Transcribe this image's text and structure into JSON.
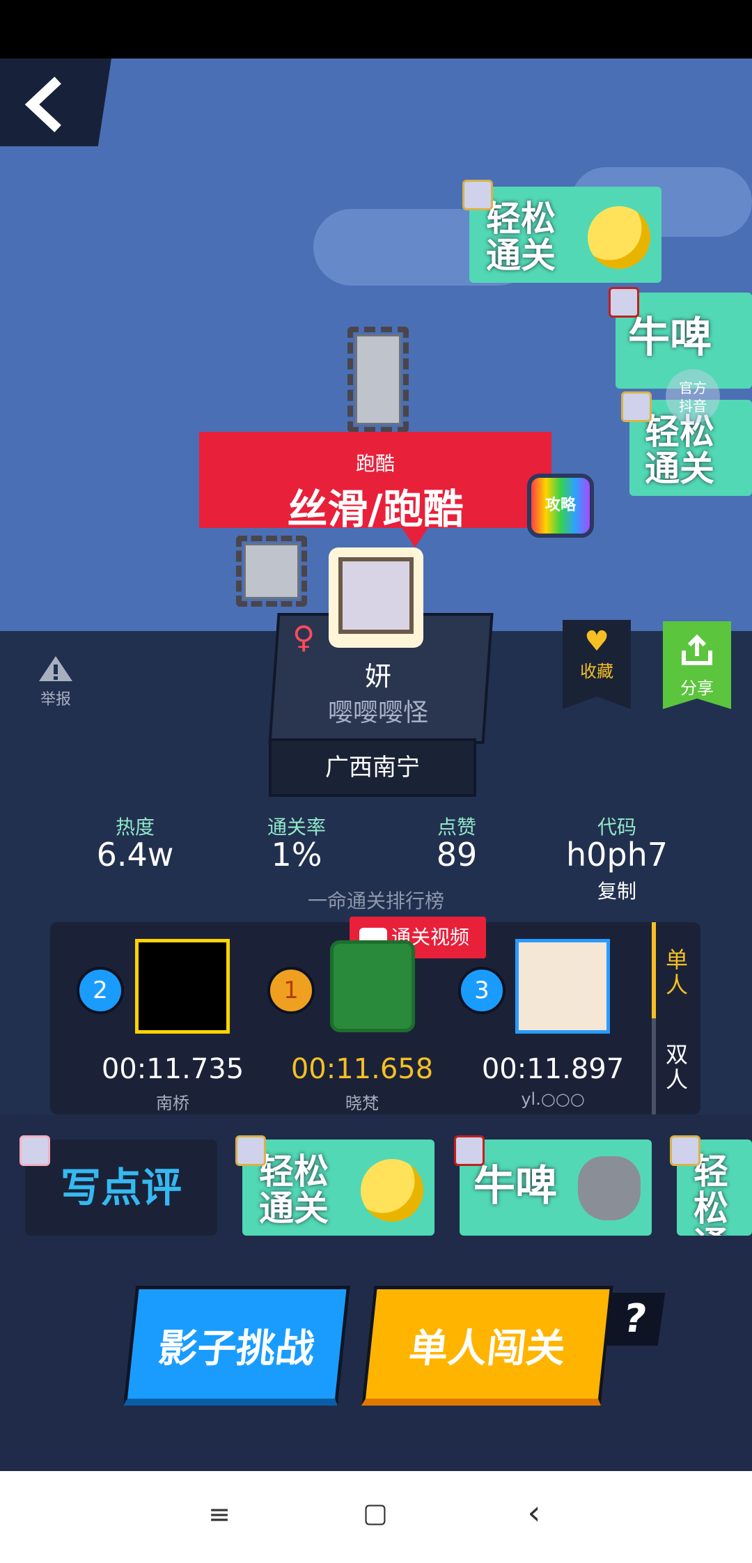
{
  "app": {
    "back_icon": "back-arrow-icon"
  },
  "reactions_top": [
    {
      "line1": "轻松",
      "line2": "通关"
    },
    {
      "line1": "牛啤",
      "line2": ""
    },
    {
      "line1": "轻松",
      "line2": "通关"
    }
  ],
  "watermark": {
    "line1": "官方",
    "line2": "抖音"
  },
  "level": {
    "category": "跑酷",
    "title": "丝滑/跑酷",
    "guide_label": "攻略"
  },
  "author": {
    "gender_symbol": "♀",
    "name": "妍",
    "subtitle": "嘤嘤嘤怪",
    "location": "广西南宁"
  },
  "actions": {
    "report": "举报",
    "favorite": "收藏",
    "share": "分享"
  },
  "stats": [
    {
      "label": "热度",
      "value": "6.4w"
    },
    {
      "label": "通关率",
      "value": "1%"
    },
    {
      "label": "点赞",
      "value": "89"
    },
    {
      "label": "代码",
      "value": "h0ph7"
    }
  ],
  "copy_label": "复制",
  "leaderboard": {
    "title": "一命通关排行榜",
    "video_label": "通关视频",
    "entries": [
      {
        "rank": "2",
        "time": "00:11.735",
        "name": "南桥"
      },
      {
        "rank": "1",
        "time": "00:11.658",
        "name": "晓梵"
      },
      {
        "rank": "3",
        "time": "00:11.897",
        "name": "yl.○○○"
      }
    ],
    "tabs": [
      {
        "label": "单人"
      },
      {
        "label": "双人"
      }
    ]
  },
  "review_label": "写点评",
  "reactions_bottom": [
    {
      "line1": "轻松",
      "line2": "通关"
    },
    {
      "line1": "牛啤",
      "line2": ""
    },
    {
      "line1": "轻松",
      "line2": "通关"
    }
  ],
  "buttons": {
    "shadow": "影子挑战",
    "single": "单人闯关",
    "help": "?"
  },
  "navbar": {
    "menu": "≡",
    "home": "▢",
    "back": "‹"
  },
  "colors": {
    "accent_blue": "#1a9cff",
    "accent_yellow": "#ffb400",
    "accent_red": "#e8203a",
    "accent_green": "#52d8b4"
  }
}
